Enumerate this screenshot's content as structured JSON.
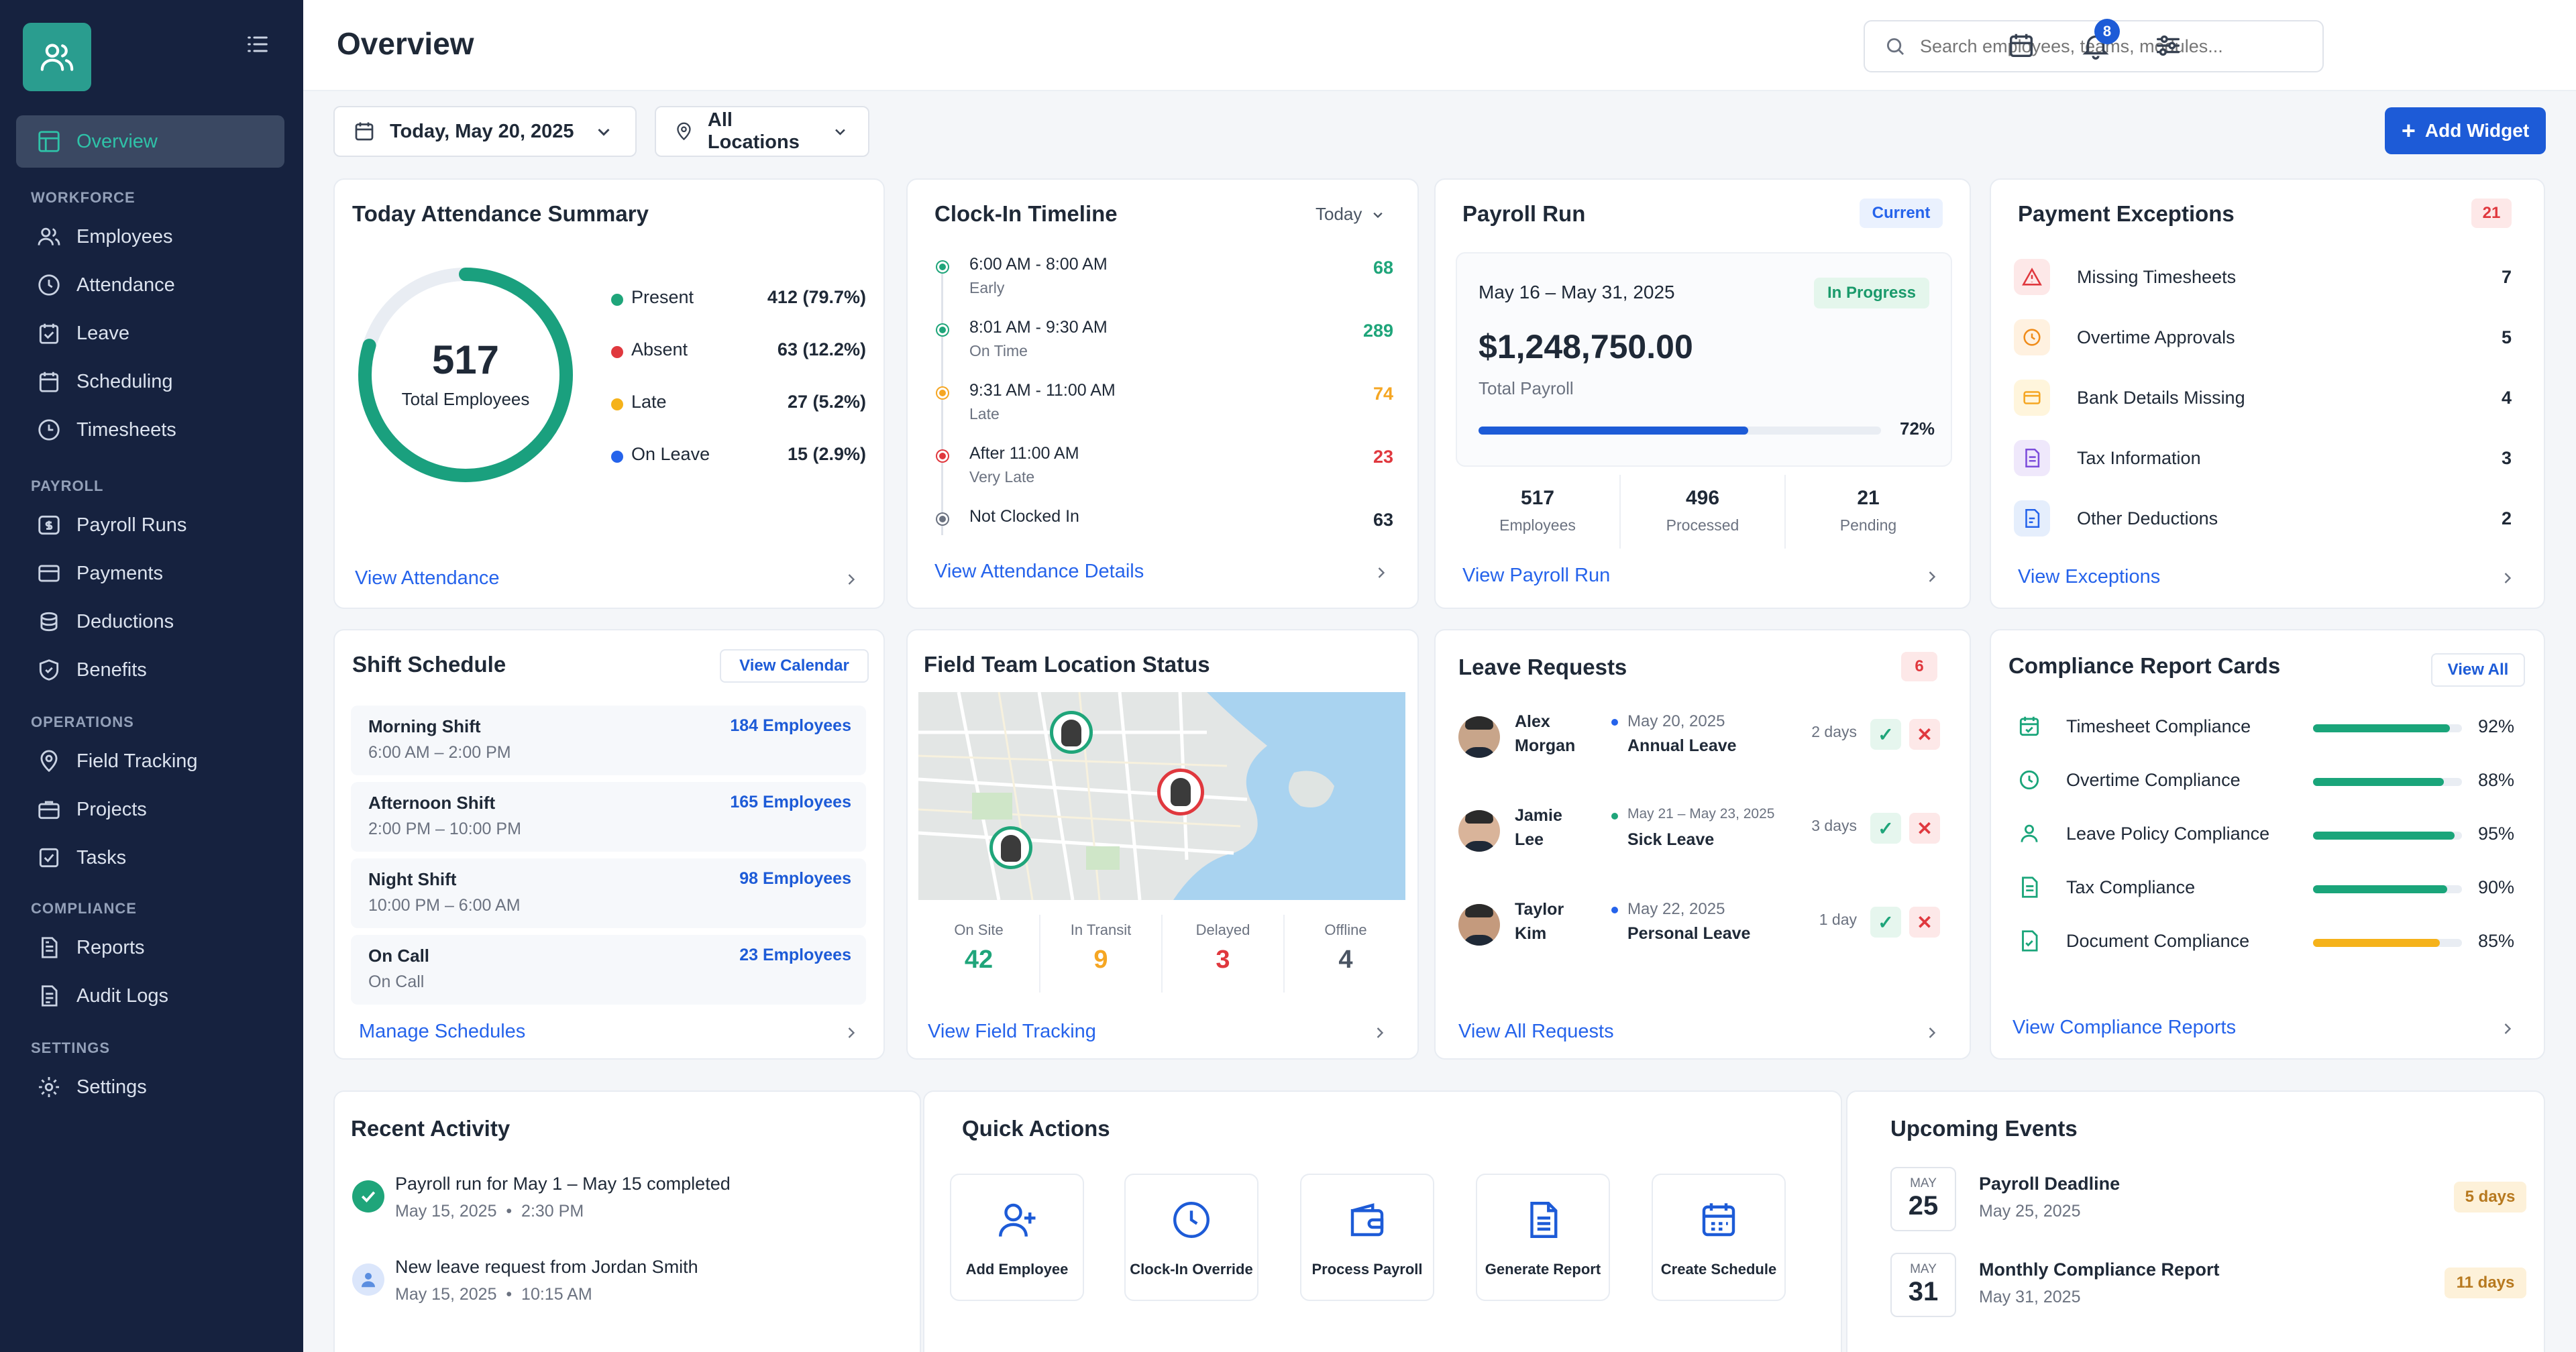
{
  "sidebar": {
    "overview": "Overview",
    "sections": {
      "workforce": "WORKFORCE",
      "payroll": "PAYROLL",
      "operations": "OPERATIONS",
      "compliance": "COMPLIANCE",
      "settings": "SETTINGS"
    },
    "items": {
      "employees": "Employees",
      "attendance": "Attendance",
      "leave": "Leave",
      "scheduling": "Scheduling",
      "timesheets": "Timesheets",
      "payroll_runs": "Payroll Runs",
      "payments": "Payments",
      "deductions": "Deductions",
      "benefits": "Benefits",
      "field_tracking": "Field Tracking",
      "projects": "Projects",
      "tasks": "Tasks",
      "reports": "Reports",
      "audit_logs": "Audit Logs",
      "settings": "Settings"
    }
  },
  "header": {
    "title": "Overview",
    "search_placeholder": "Search employees, teams, modules...",
    "notification_count": "8"
  },
  "filters": {
    "date": "Today, May 20, 2025",
    "location": "All Locations",
    "add_widget": "Add Widget"
  },
  "attendance": {
    "title": "Today Attendance Summary",
    "total": "517",
    "total_label": "Total Employees",
    "rows": [
      {
        "label": "Present",
        "value": "412 (79.7%)",
        "color": "#1fa57a"
      },
      {
        "label": "Absent",
        "value": "63 (12.2%)",
        "color": "#e0383e"
      },
      {
        "label": "Late",
        "value": "27 (5.2%)",
        "color": "#f5b21a"
      },
      {
        "label": "On Leave",
        "value": "15 (2.9%)",
        "color": "#2563eb"
      }
    ],
    "present_fraction": 0.797,
    "link": "View Attendance"
  },
  "clockin": {
    "title": "Clock-In Timeline",
    "range": "Today",
    "rows": [
      {
        "time": "6:00 AM - 8:00 AM",
        "label": "Early",
        "count": "68",
        "color": "#1fa57a"
      },
      {
        "time": "8:01 AM - 9:30 AM",
        "label": "On Time",
        "count": "289",
        "color": "#1fa57a"
      },
      {
        "time": "9:31 AM - 11:00 AM",
        "label": "Late",
        "count": "74",
        "color": "#f5a623"
      },
      {
        "time": "After 11:00 AM",
        "label": "Very Late",
        "count": "23",
        "color": "#e0383e"
      },
      {
        "time": "Not Clocked In",
        "label": "",
        "count": "63",
        "color": "#6b7280"
      }
    ],
    "link": "View Attendance Details"
  },
  "payroll": {
    "title": "Payroll Run",
    "tag": "Current",
    "period": "May 16 – May 31, 2025",
    "status": "In Progress",
    "amount": "$1,248,750.00",
    "amount_label": "Total Payroll",
    "progress_text": "72%",
    "progress": 0.72,
    "stats": [
      {
        "value": "517",
        "label": "Employees"
      },
      {
        "value": "496",
        "label": "Processed"
      },
      {
        "value": "21",
        "label": "Pending"
      }
    ],
    "link": "View Payroll Run"
  },
  "exceptions": {
    "title": "Payment Exceptions",
    "count": "21",
    "rows": [
      {
        "label": "Missing Timesheets",
        "count": "7",
        "icon": "alert-triangle-icon",
        "color": "#e0383e",
        "bg": "#fde8e8"
      },
      {
        "label": "Overtime Approvals",
        "count": "5",
        "icon": "clock-icon",
        "color": "#f08c1a",
        "bg": "#fff1e0"
      },
      {
        "label": "Bank Details Missing",
        "count": "4",
        "icon": "card-icon",
        "color": "#f5a623",
        "bg": "#fff5dc"
      },
      {
        "label": "Tax Information",
        "count": "3",
        "icon": "document-icon",
        "color": "#7c4ddb",
        "bg": "#efe8fb"
      },
      {
        "label": "Other Deductions",
        "count": "2",
        "icon": "file-icon",
        "color": "#2563eb",
        "bg": "#e5eefc"
      }
    ],
    "link": "View Exceptions"
  },
  "shifts": {
    "title": "Shift Schedule",
    "calendar_btn": "View Calendar",
    "rows": [
      {
        "name": "Morning Shift",
        "time": "6:00 AM – 2:00 PM",
        "count": "184 Employees"
      },
      {
        "name": "Afternoon Shift",
        "time": "2:00 PM – 10:00 PM",
        "count": "165 Employees"
      },
      {
        "name": "Night Shift",
        "time": "10:00 PM – 6:00 AM",
        "count": "98 Employees"
      },
      {
        "name": "On Call",
        "time": "On Call",
        "count": "23 Employees"
      }
    ],
    "link": "Manage Schedules"
  },
  "field": {
    "title": "Field Team Location Status",
    "stats": [
      {
        "label": "On Site",
        "value": "42",
        "color": "#1fa57a"
      },
      {
        "label": "In Transit",
        "value": "9",
        "color": "#f5a623"
      },
      {
        "label": "Delayed",
        "value": "3",
        "color": "#e0383e"
      },
      {
        "label": "Offline",
        "value": "4",
        "color": "#4b5563"
      }
    ],
    "link": "View Field Tracking"
  },
  "leave": {
    "title": "Leave Requests",
    "count": "6",
    "rows": [
      {
        "first": "Alex",
        "last": "Morgan",
        "date": "May 20, 2025",
        "type": "Annual Leave",
        "days": "2 days",
        "dot": "#2563eb"
      },
      {
        "first": "Jamie",
        "last": "Lee",
        "date": "May 21 – May 23, 2025",
        "type": "Sick Leave",
        "days": "3 days",
        "dot": "#1fa57a"
      },
      {
        "first": "Taylor",
        "last": "Kim",
        "date": "May 22, 2025",
        "type": "Personal Leave",
        "days": "1 day",
        "dot": "#2563eb"
      }
    ],
    "approve": "✓",
    "reject": "✕",
    "link": "View All Requests"
  },
  "compliance": {
    "title": "Compliance Report Cards",
    "view_all": "View All",
    "rows": [
      {
        "label": "Timesheet Compliance",
        "pct": "92%",
        "value": 0.92,
        "color": "#1aa57a",
        "icon": "calendar-check-icon"
      },
      {
        "label": "Overtime Compliance",
        "pct": "88%",
        "value": 0.88,
        "color": "#1aa57a",
        "icon": "clock-icon"
      },
      {
        "label": "Leave Policy Compliance",
        "pct": "95%",
        "value": 0.95,
        "color": "#1aa57a",
        "icon": "user-icon"
      },
      {
        "label": "Tax Compliance",
        "pct": "90%",
        "value": 0.9,
        "color": "#1aa57a",
        "icon": "document-icon"
      },
      {
        "label": "Document Compliance",
        "pct": "85%",
        "value": 0.85,
        "color": "#f5b21a",
        "icon": "file-check-icon"
      }
    ],
    "link": "View Compliance Reports"
  },
  "activity": {
    "title": "Recent Activity",
    "rows": [
      {
        "text": "Payroll run for May 1 – May 15 completed",
        "date": "May 15, 2025",
        "time": "2:30 PM"
      },
      {
        "text": "New leave request from Jordan Smith",
        "date": "May 15, 2025",
        "time": "10:15 AM"
      }
    ]
  },
  "quick": {
    "title": "Quick Actions",
    "actions": [
      "Add Employee",
      "Clock-In Override",
      "Process Payroll",
      "Generate Report",
      "Create Schedule"
    ]
  },
  "events": {
    "title": "Upcoming Events",
    "rows": [
      {
        "month": "MAY",
        "day": "25",
        "name": "Payroll Deadline",
        "date": "May 25, 2025",
        "badge": "5 days"
      },
      {
        "month": "MAY",
        "day": "31",
        "name": "Monthly Compliance Report",
        "date": "May 31, 2025",
        "badge": "11 days"
      }
    ]
  },
  "colors": {
    "sidebar_bg": "#16223f",
    "accent_teal": "#2a9d8f",
    "primary_blue": "#1d5bd7"
  }
}
